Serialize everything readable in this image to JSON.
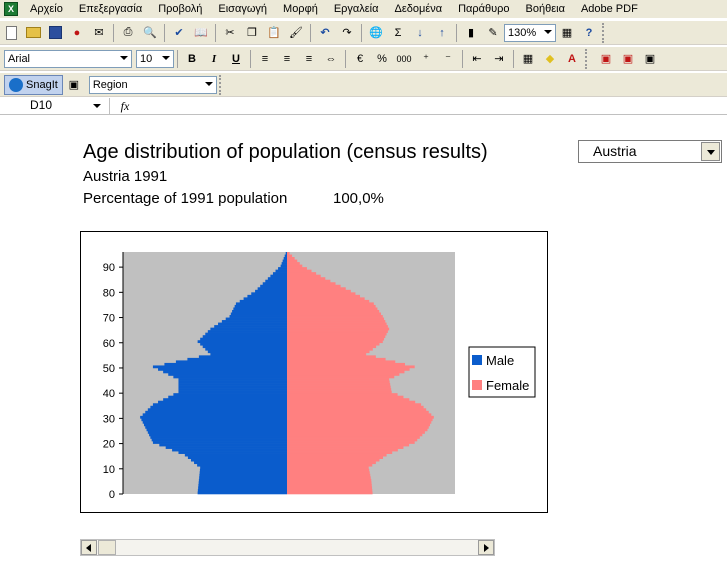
{
  "menu": {
    "items": [
      "Αρχείο",
      "Επεξεργασία",
      "Προβολή",
      "Εισαγωγή",
      "Μορφή",
      "Εργαλεία",
      "Δεδομένα",
      "Παράθυρο",
      "Βοήθεια",
      "Adobe PDF"
    ]
  },
  "toolbar": {
    "zoom": "130%",
    "font_name": "Arial",
    "font_size": "10",
    "bold": "B",
    "italic": "I",
    "underline": "U",
    "percent": "%",
    "thousands": "000",
    "snagit": "SnagIt",
    "region_combo": "Region"
  },
  "formula_bar": {
    "name_box": "D10",
    "fx": "fx"
  },
  "sheet": {
    "title": "Age distribution of population (census results)",
    "subtitle": "Austria 1991",
    "pct_label": "Percentage of 1991 population",
    "pct_value": "100,0%",
    "country_select": "Austria"
  },
  "chart_data": {
    "type": "bar",
    "orientation": "horizontal-pyramid",
    "y_ticks": [
      "0",
      "10",
      "20",
      "30",
      "40",
      "50",
      "60",
      "70",
      "80",
      "90"
    ],
    "ylim": [
      0,
      96
    ],
    "legend": [
      "Male",
      "Female"
    ],
    "legend_placement": "right",
    "colors": {
      "male": "#0a5ccc",
      "female": "#ff8080",
      "plot_bg": "#c0c0c0"
    },
    "ages": [
      0,
      5,
      10,
      15,
      20,
      25,
      30,
      35,
      40,
      45,
      50,
      55,
      60,
      65,
      70,
      75,
      80,
      85,
      90,
      95
    ],
    "male": [
      0.7,
      0.69,
      0.68,
      0.8,
      1.05,
      1.1,
      1.15,
      1.05,
      0.85,
      0.85,
      1.05,
      0.6,
      0.7,
      0.6,
      0.45,
      0.4,
      0.25,
      0.15,
      0.05,
      0.01
    ],
    "female": [
      0.67,
      0.66,
      0.64,
      0.78,
      1.0,
      1.1,
      1.15,
      1.05,
      0.82,
      0.8,
      1.0,
      0.62,
      0.75,
      0.8,
      0.75,
      0.68,
      0.5,
      0.3,
      0.12,
      0.02
    ]
  }
}
